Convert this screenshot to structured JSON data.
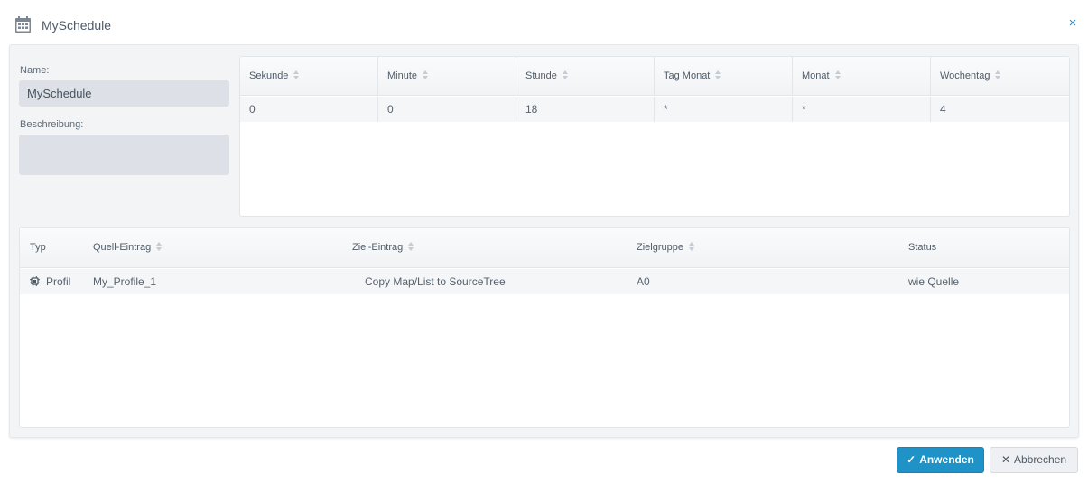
{
  "dialog": {
    "title": "MySchedule",
    "close_label": "×",
    "accent_color": "#1f93c7"
  },
  "form": {
    "name_label": "Name:",
    "name_value": "MySchedule",
    "description_label": "Beschreibung:",
    "description_value": ""
  },
  "cron": {
    "columns": [
      "Sekunde",
      "Minute",
      "Stunde",
      "Tag Monat",
      "Monat",
      "Wochentag"
    ],
    "row": [
      "0",
      "0",
      "18",
      "*",
      "*",
      "4"
    ]
  },
  "entries": {
    "columns": {
      "type": "Typ",
      "source": "Quell-Eintrag",
      "target": "Ziel-Eintrag",
      "group": "Zielgruppe",
      "status": "Status"
    },
    "rows": [
      {
        "type_icon": "chip-icon",
        "type": "Profil",
        "source": "My_Profile_1",
        "target": "Copy Map/List to SourceTree",
        "group": "A0",
        "status": "wie Quelle"
      }
    ]
  },
  "buttons": {
    "apply_glyph": "✓",
    "apply": "Anwenden",
    "cancel_glyph": "✕",
    "cancel": "Abbrechen"
  }
}
